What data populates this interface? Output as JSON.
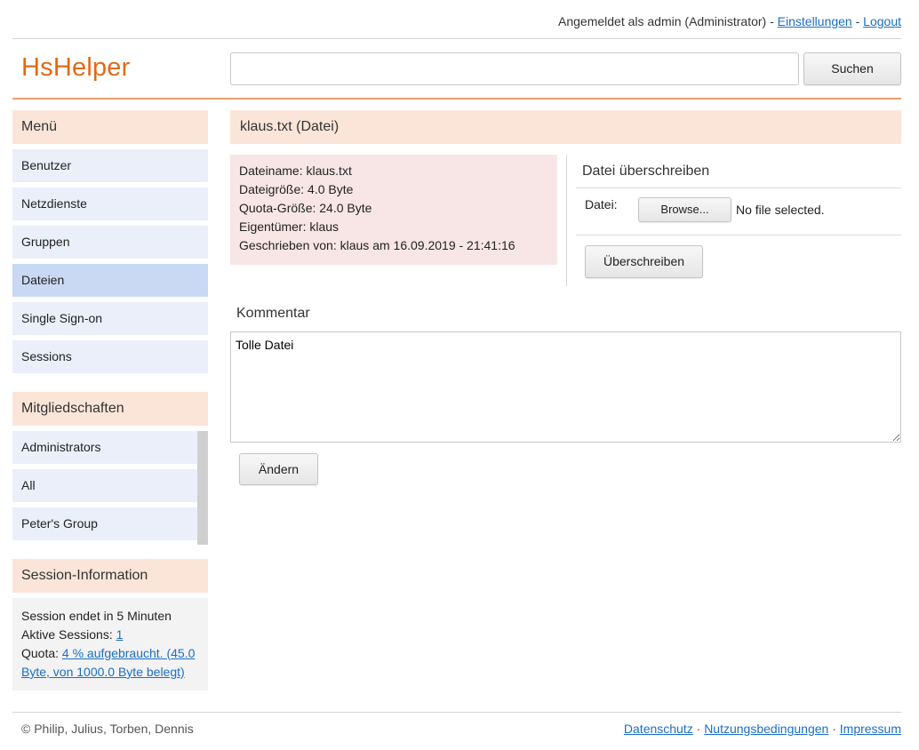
{
  "topbar": {
    "logged_in_prefix": "Angemeldet als admin (Administrator) - ",
    "settings_link": "Einstellungen",
    "separator": " - ",
    "logout_link": "Logout"
  },
  "header": {
    "logo": "HsHelper",
    "search_value": "",
    "search_button": "Suchen"
  },
  "sidebar": {
    "menu_title": "Menü",
    "menu_items": [
      {
        "label": "Benutzer",
        "active": false
      },
      {
        "label": "Netzdienste",
        "active": false
      },
      {
        "label": "Gruppen",
        "active": false
      },
      {
        "label": "Dateien",
        "active": true
      },
      {
        "label": "Single Sign-on",
        "active": false
      },
      {
        "label": "Sessions",
        "active": false
      }
    ],
    "memberships_title": "Mitgliedschaften",
    "memberships": [
      "Administrators",
      "All",
      "Peter's Group"
    ],
    "session_title": "Session-Information",
    "session_ends": "Session endet in 5 Minuten",
    "active_sessions_label": "Aktive Sessions: ",
    "active_sessions_value": "1",
    "quota_label": "Quota: ",
    "quota_link": "4 % aufgebraucht. (45.0 Byte, von 1000.0 Byte belegt)"
  },
  "main": {
    "title": "klaus.txt (Datei)",
    "info": [
      "Dateiname: klaus.txt",
      "Dateigröße: 4.0 Byte",
      "Quota-Größe: 24.0 Byte",
      "Eigentümer: klaus",
      "Geschrieben von: klaus am 16.09.2019 - 21:41:16"
    ],
    "overwrite_title": "Datei überschreiben",
    "file_label": "Datei:",
    "browse_button": "Browse...",
    "file_status": "No file selected.",
    "overwrite_button": "Überschreiben",
    "comment_label": "Kommentar",
    "comment_value": "Tolle Datei",
    "change_button": "Ändern"
  },
  "footer": {
    "copyright": "© Philip, Julius, Torben, Dennis",
    "links": [
      "Datenschutz",
      "Nutzungsbedingungen",
      "Impressum"
    ],
    "link_separator": " · "
  },
  "colors": {
    "brand": "#e06a17",
    "panel_header": "#fbe5d9",
    "menu_item": "#eaeffa",
    "menu_active": "#c9d9f4",
    "info_box": "#f8e6e6",
    "link": "#1a6fc4"
  }
}
